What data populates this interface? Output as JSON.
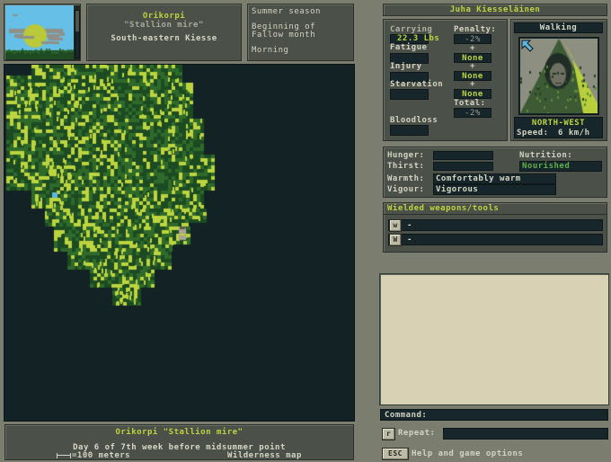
{
  "weather_view": {
    "icon": "sun-behind-clouds-icon",
    "sky_color": "#66bfe6",
    "sun_color": "#b9c93a",
    "cloud_color": "#8f9189",
    "daylight_gauge": 0.55
  },
  "location": {
    "name": "Orikorpi",
    "nickname": "\"Stallion mire\"",
    "region": "South-eastern Kiesse"
  },
  "time_info": {
    "season": "Summer season",
    "month_line1": "Beginning of",
    "month_line2": "Fallow month",
    "time_of_day": "Morning"
  },
  "character": {
    "name": "Juha Kiesseläinen",
    "carrying_label": "Carrying",
    "carrying_value": "22.3 Lbs",
    "penalty_label": "Penalty:",
    "penalty_value": "-2%",
    "fatigue_label": "Fatigue",
    "fatigue_penalty": "None",
    "injury_label": "Injury",
    "injury_penalty": "None",
    "starvation_label": "Starvation",
    "starvation_penalty": "None",
    "plus_sign": "+",
    "total_label": "Total:",
    "total_value": "-2%",
    "bloodloss_label": "Bloodloss",
    "movement_mode": "Walking",
    "direction": "NORTH-WEST",
    "speed_label": "Speed:",
    "speed_value": "6 km/h",
    "direction_icon": "north-west-arrow-icon"
  },
  "condition": {
    "hunger_label": "Hunger:",
    "hunger_value": "",
    "thirst_label": "Thirst:",
    "thirst_value": "",
    "nutrition_label": "Nutrition:",
    "nutrition_value": "Nourished",
    "warmth_label": "Warmth:",
    "warmth_value": "Comfortably warm",
    "vigour_label": "Vigour:",
    "vigour_value": "Vigorous"
  },
  "weapons": {
    "title": "Wielded weapons/tools",
    "slots": [
      {
        "key": "w",
        "value": "-"
      },
      {
        "key": "W",
        "value": "-"
      }
    ]
  },
  "message_log": {
    "lines": []
  },
  "command": {
    "label": "Command:",
    "value": "",
    "repeat_key": "r",
    "repeat_label": "Repeat:",
    "repeat_value": "",
    "help_key": "ESC",
    "help_label": "Help and game options"
  },
  "map_footer": {
    "place": "Orikorpi \"Stallion mire\"",
    "date": "Day 6 of 7th week before midsummer point",
    "scale_label": "=100 meters",
    "map_type": "Wilderness map"
  },
  "map": {
    "background": "#132225",
    "tree_dark": "#1c4a22",
    "tree_mid": "#2f6a2a",
    "tree_light": "#bcd43e",
    "water": "#5bb7e0",
    "player_color": "#a9a493"
  }
}
